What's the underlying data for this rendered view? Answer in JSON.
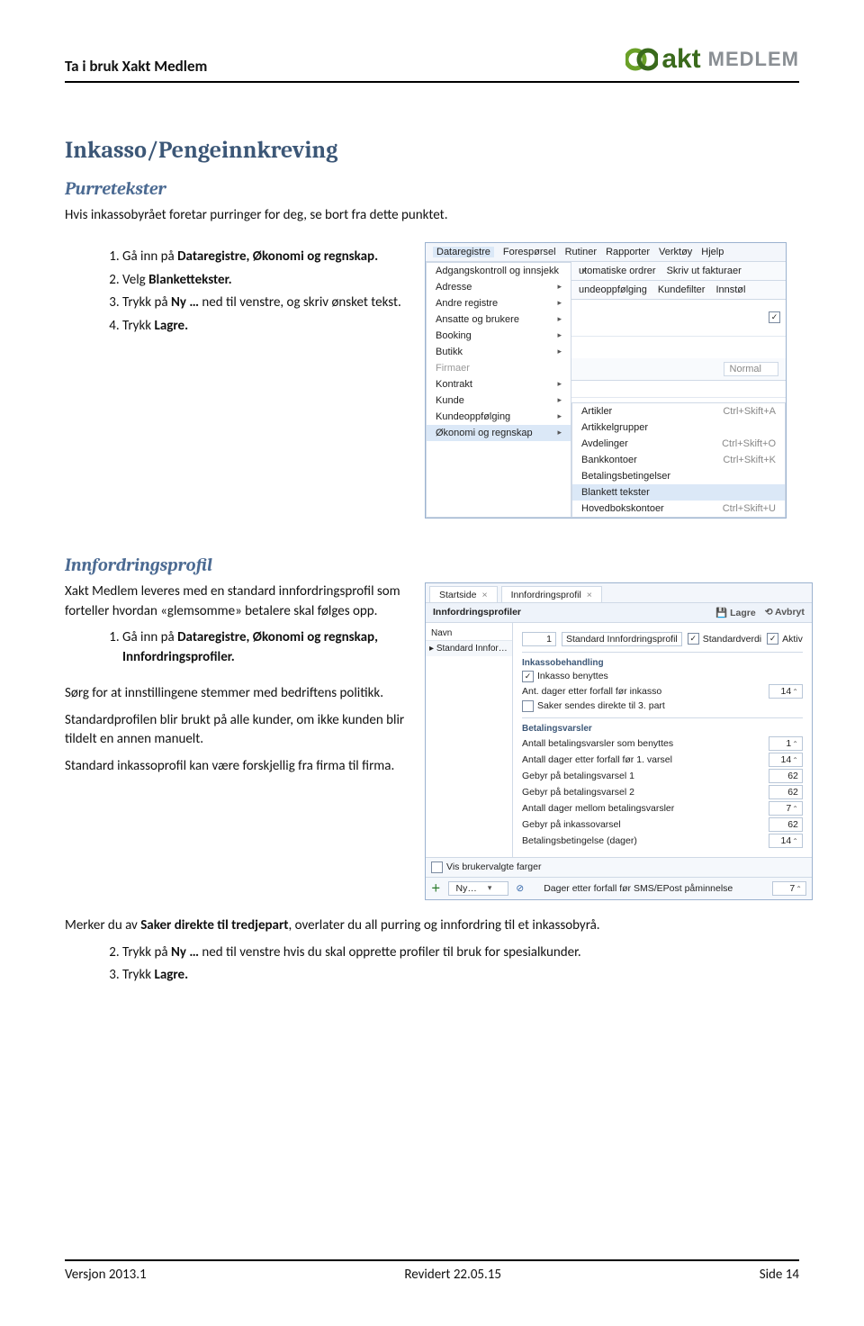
{
  "header": {
    "title": "Ta i bruk Xakt Medlem",
    "logo_text_1": "akt",
    "logo_text_2": "MEDLEM"
  },
  "s1": {
    "h1": "Inkasso/Pengeinnkreving",
    "h2": "Purretekster",
    "intro": "Hvis inkassobyrået foretar purringer for deg, se bort fra dette punktet.",
    "steps": {
      "s1a": "Gå inn på ",
      "s1b": "Dataregistre, Økonomi og regnskap.",
      "s2a": "Velg ",
      "s2b": "Blankettekster.",
      "s3a": "Trykk på ",
      "s3b": "Ny …",
      "s3c": " ned til venstre, og skriv ønsket tekst.",
      "s4a": "Trykk ",
      "s4b": "Lagre."
    }
  },
  "scr1": {
    "menu": [
      "Dataregistre",
      "Forespørsel",
      "Rutiner",
      "Rapporter",
      "Verktøy",
      "Hjelp"
    ],
    "tool": {
      "a": "Adgangskontroll og innsjekk",
      "b": "utomatiske ordrer",
      "c": "Skriv ut fakturaer"
    },
    "tool2": {
      "a": "undeoppfølging",
      "b": "Kundefilter",
      "c": "Innstøl"
    },
    "drop1": [
      "Adresse",
      "Andre registre",
      "Ansatte og brukere",
      "Booking",
      "Butikk",
      "Firmaer",
      "Kontrakt",
      "Kunde",
      "Kundeoppfølging"
    ],
    "drop1_hl": "Økonomi og regnskap",
    "drop2": [
      {
        "l": "Artikler",
        "s": "Ctrl+Skift+A"
      },
      {
        "l": "Artikkelgrupper",
        "s": ""
      },
      {
        "l": "Avdelinger",
        "s": "Ctrl+Skift+O"
      },
      {
        "l": "Bankkontoer",
        "s": "Ctrl+Skift+K"
      },
      {
        "l": "Betalingsbetingelser",
        "s": ""
      }
    ],
    "drop2_hl": {
      "l": "Blankett tekster",
      "s": ""
    },
    "drop2_after": {
      "l": "Hovedbokskontoer",
      "s": "Ctrl+Skift+U"
    },
    "formatbar": "Normal"
  },
  "s2": {
    "h2": "Innfordringsprofil",
    "p1a": "Xakt Medlem leveres med en standard innfordringsprofil som forteller hvordan «glemsomme» betalere skal følges opp.",
    "st1a": "Gå inn på ",
    "st1b": "Dataregistre, Økonomi og regnskap, Innfordringsprofiler.",
    "p2": "Sørg for at innstillingene stemmer med bedriftens politikk.",
    "p3": "Standardprofilen blir brukt på alle kunder, om ikke kunden blir tildelt en annen manuelt.",
    "p4": "Standard inkassoprofil kan være forskjellig fra firma til firma.",
    "p5a": "Merker du av ",
    "p5b": "Saker direkte til tredjepart",
    "p5c": ", overlater du all purring og innfordring til et inkassobyrå.",
    "st2a": "Trykk på ",
    "st2b": "Ny …",
    "st2c": " ned til venstre hvis du skal opprette profiler til bruk for spesialkunder.",
    "st3a": "Trykk ",
    "st3b": "Lagre."
  },
  "scr2": {
    "tabs": {
      "a": "Startside",
      "b": "Innfordringsprofil"
    },
    "subhead": {
      "a": "Innfordringsprofiler",
      "lagre": "Lagre",
      "avbryt": "Avbryt"
    },
    "side_head": "Navn",
    "side_row": "Standard Innfordringsprofil",
    "name_val": "Standard Innfordringsprofil",
    "num_val": "1",
    "cb_std": "Standardverdi",
    "cb_aktiv": "Aktiv",
    "grp1": "Inkassobehandling",
    "g1_cb": "Inkasso benyttes",
    "g1_r1": "Ant. dager etter forfall før inkasso",
    "g1_v1": "14",
    "g1_cb2": "Saker sendes direkte til 3. part",
    "grp2": "Betalingsvarsler",
    "g2_r1": "Antall betalingsvarsler som benyttes",
    "g2_v1": "1",
    "g2_r2": "Antall dager etter forfall før 1. varsel",
    "g2_v2": "14",
    "g2_r3": "Gebyr på betalingsvarsel 1",
    "g2_v3": "62",
    "g2_r4": "Gebyr på betalingsvarsel 2",
    "g2_v4": "62",
    "g2_r5": "Antall dager mellom betalingsvarsler",
    "g2_v5": "7",
    "g2_r6": "Gebyr på inkassovarsel",
    "g2_v6": "62",
    "g2_r7": "Betalingsbetingelse (dager)",
    "g2_v7": "14",
    "bottom_cb": "Vis brukervalgte farger",
    "ny": "Ny…",
    "last_r": "Dager etter forfall før SMS/EPost påminnelse",
    "last_v": "7"
  },
  "footer": {
    "l": "Versjon 2013.1",
    "c": "Revidert 22.05.15",
    "r": "Side 14"
  }
}
